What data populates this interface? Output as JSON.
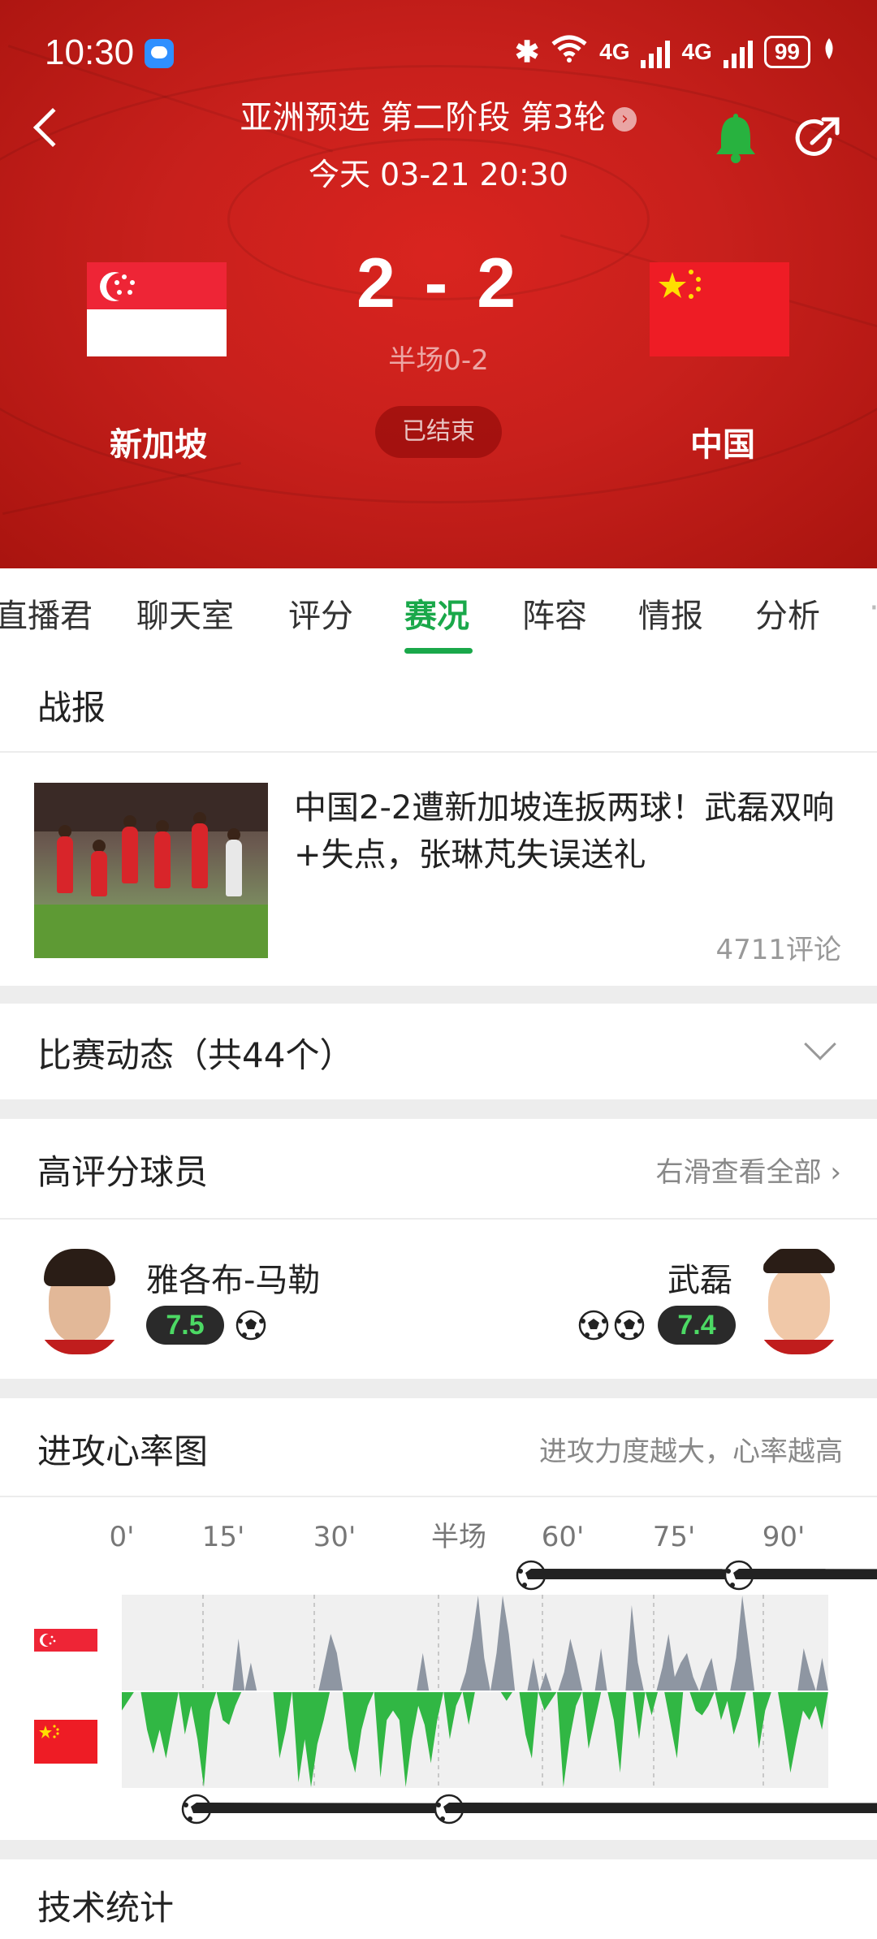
{
  "status_bar": {
    "time": "10:30",
    "network_1": "4G",
    "network_2": "4G",
    "battery": "99"
  },
  "match": {
    "league": "亚洲预选 第二阶段 第3轮",
    "datetime": "今天 03-21 20:30",
    "home_team": "新加坡",
    "away_team": "中国",
    "score": "2 - 2",
    "halftime": "半场0-2",
    "status": "已结束"
  },
  "tabs": [
    {
      "label": "直播君"
    },
    {
      "label": "聊天室"
    },
    {
      "label": "评分"
    },
    {
      "label": "赛况",
      "active": true
    },
    {
      "label": "阵容"
    },
    {
      "label": "情报"
    },
    {
      "label": "分析"
    }
  ],
  "report": {
    "title": "战报",
    "headline": "中国2-2遭新加坡连扳两球！武磊双响+失点，张琳芃失误送礼",
    "comments": "4711评论"
  },
  "events": {
    "title": "比赛动态（共44个）"
  },
  "top_players": {
    "title": "高评分球员",
    "more": "右滑查看全部",
    "home": {
      "name": "雅各布-马勒",
      "rating": "7.5",
      "goals": 1
    },
    "away": {
      "name": "武磊",
      "rating": "7.4",
      "goals": 2
    }
  },
  "attack_chart": {
    "title": "进攻心率图",
    "hint": "进攻力度越大，心率越高"
  },
  "chart_data": {
    "type": "area",
    "x_ticks": [
      "0'",
      "15'",
      "30'",
      "半场",
      "60'",
      "75'",
      "90'"
    ],
    "series": [
      {
        "values": [
          0,
          0,
          0,
          0,
          0,
          0,
          0,
          0,
          0,
          0,
          0,
          0,
          0,
          0,
          0,
          0,
          0,
          0,
          0,
          0.55,
          0,
          0.3,
          0,
          0,
          0,
          0,
          0,
          0,
          0,
          0,
          0,
          0,
          0,
          0.3,
          0.6,
          0.4,
          0,
          0,
          0,
          0,
          0,
          0,
          0,
          0,
          0,
          0,
          0,
          0,
          0,
          0.4,
          0,
          0,
          0,
          0,
          0,
          0,
          0.2,
          0.55,
          1,
          0.35,
          0,
          0.4,
          1,
          0.6,
          0,
          0,
          0,
          0.35,
          0,
          0.2,
          0,
          0,
          0.2,
          0.55,
          0.3,
          0,
          0,
          0,
          0.45,
          0,
          0,
          0,
          0,
          0.9,
          0.3,
          0,
          0,
          0,
          0.25,
          0.6,
          0.15,
          0.3,
          0.4,
          0.15,
          0,
          0.2,
          0.35,
          0,
          0,
          0,
          0.35,
          1,
          0.5,
          0,
          0,
          0,
          0,
          0,
          0,
          0,
          0,
          0.45,
          0.2,
          0,
          0.35,
          0
        ]
      },
      {
        "values": [
          -0.2,
          -0.1,
          0,
          0,
          -0.4,
          -0.65,
          -0.4,
          -0.7,
          -0.35,
          0,
          -0.45,
          -0.15,
          -0.5,
          -1,
          -0.2,
          0,
          -0.3,
          -0.35,
          -0.15,
          0,
          0,
          0,
          0,
          0,
          0,
          -0.7,
          -0.4,
          0,
          -0.95,
          -0.5,
          -1,
          -0.55,
          -0.3,
          0,
          0,
          0,
          -0.6,
          -0.85,
          -0.4,
          -0.15,
          0,
          -0.9,
          -0.3,
          -0.2,
          -0.3,
          -1,
          -0.5,
          -0.15,
          -0.35,
          -0.75,
          -0.3,
          0,
          -0.5,
          -0.15,
          0,
          -0.35,
          0,
          0,
          0,
          0,
          0,
          -0.1,
          0,
          0,
          -0.45,
          -0.7,
          0,
          -0.2,
          -0.1,
          0,
          -1,
          -0.5,
          -0.15,
          0,
          -0.6,
          -0.3,
          0,
          0,
          -0.3,
          -0.85,
          0,
          0,
          -0.5,
          0,
          -0.25,
          0,
          0,
          -0.35,
          -0.7,
          0,
          0,
          -0.2,
          -0.25,
          -0.15,
          0,
          -0.3,
          -0.1,
          -0.45,
          -0.25,
          0,
          0,
          -0.6,
          -0.2,
          0,
          0,
          -0.4,
          -0.85,
          -0.5,
          -0.2,
          -0.3,
          -0.15,
          -0.4,
          0
        ]
      }
    ],
    "goal_minutes_top": [
      55,
      83
    ],
    "goal_minutes_bottom": [
      10,
      44
    ]
  },
  "stats": {
    "title": "技术统计"
  }
}
